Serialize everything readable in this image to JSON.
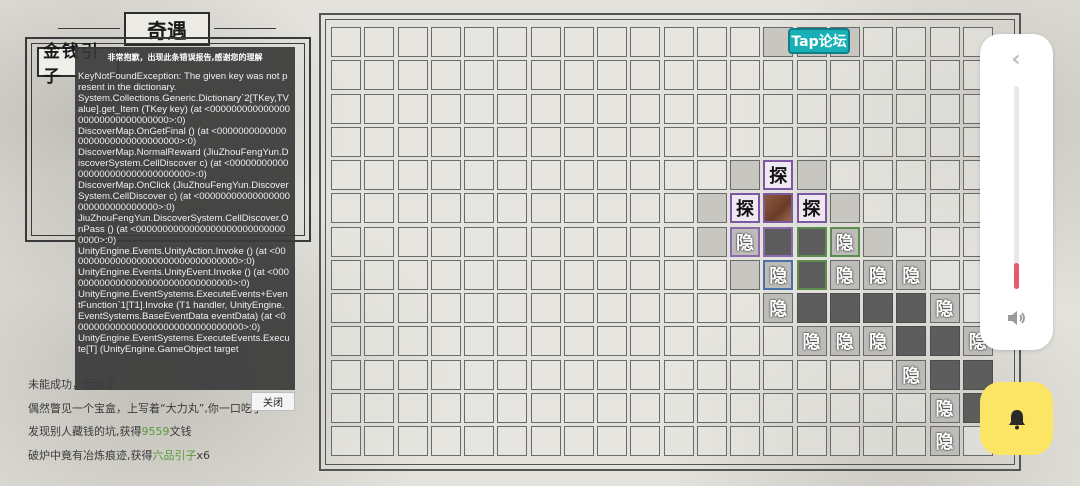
{
  "page": {
    "title": "奇遇"
  },
  "left_panel": {
    "money_label": "金钱引子"
  },
  "error": {
    "title": "非常抱歉，出现此条错误报告,感谢您的理解",
    "message": "KeyNotFoundException: The given key was not present in the dictionary.\nSystem.Collections.Generic.Dictionary`2[TKey,TValue].get_Item (TKey key) (at <00000000000000000000000000000000>:0)\nDiscoverMap.OnGetFinal () (at <00000000000000000000000000000000>:0)\nDiscoverMap.NormalReward (JiuZhouFengYun.DiscoverSystem.CellDiscover c) (at <00000000000000000000000000000000>:0)\nDiscoverMap.OnClick (JiuZhouFengYun.DiscoverSystem.CellDiscover c) (at <00000000000000000000000000000000>:0)\nJiuZhouFengYun.DiscoverSystem.CellDiscover.OnPass () (at <00000000000000000000000000000000>:0)\nUnityEngine.Events.UnityAction.Invoke () (at <00000000000000000000000000000000>:0)\nUnityEngine.Events.UnityEvent.Invoke () (at <00000000000000000000000000000000>:0)\nUnityEngine.EventSystems.ExecuteEvents+EventFunction`1[T1].Invoke (T1 handler, UnityEngine.EventSystems.BaseEventData eventData) (at <00000000000000000000000000000000>:0)\nUnityEngine.EventSystems.ExecuteEvents.Execute[T] (UnityEngine.GameObject target",
    "close_label": "关闭"
  },
  "log": [
    {
      "parts": [
        {
          "text": "未能成功，"
        },
        {
          "text": "后退了"
        }
      ]
    },
    {
      "parts": [
        {
          "text": "偶然瞥见一个宝盒，上写着“大力丸”,你一口吃了"
        }
      ]
    },
    {
      "parts": [
        {
          "text": "发现别人藏钱的坑,获得"
        },
        {
          "text": "9559",
          "hl": true
        },
        {
          "text": "文钱"
        }
      ]
    },
    {
      "parts": [
        {
          "text": "破炉中竟有冶炼痕迹,获得"
        },
        {
          "text": "六品引子",
          "hl": true
        },
        {
          "text": "x6"
        }
      ]
    }
  ],
  "board": {
    "cols": 20,
    "rows": 13,
    "tap_badge": "Tap论坛",
    "special_cells": [
      {
        "r": 4,
        "c": 13,
        "type": "explore",
        "label": "探"
      },
      {
        "r": 5,
        "c": 12,
        "type": "explore",
        "label": "探"
      },
      {
        "r": 5,
        "c": 13,
        "type": "rock",
        "label": ""
      },
      {
        "r": 5,
        "c": 14,
        "type": "explore",
        "label": "探"
      },
      {
        "r": 6,
        "c": 12,
        "type": "hidden",
        "label": "隐",
        "border": "purple"
      },
      {
        "r": 6,
        "c": 13,
        "type": "purple-dark",
        "label": ""
      },
      {
        "r": 6,
        "c": 14,
        "type": "green-dark",
        "label": ""
      },
      {
        "r": 6,
        "c": 15,
        "type": "hidden",
        "label": "隐",
        "border": "green"
      },
      {
        "r": 7,
        "c": 13,
        "type": "hidden",
        "label": "隐",
        "border": "blue"
      },
      {
        "r": 7,
        "c": 14,
        "type": "green-dark",
        "label": ""
      },
      {
        "r": 7,
        "c": 15,
        "type": "hidden",
        "label": "隐"
      },
      {
        "r": 7,
        "c": 16,
        "type": "hidden",
        "label": "隐"
      },
      {
        "r": 7,
        "c": 17,
        "type": "hidden",
        "label": "隐"
      },
      {
        "r": 8,
        "c": 13,
        "type": "hidden",
        "label": "隐"
      },
      {
        "r": 8,
        "c": 14,
        "type": "dark",
        "label": ""
      },
      {
        "r": 8,
        "c": 15,
        "type": "dark",
        "label": ""
      },
      {
        "r": 8,
        "c": 16,
        "type": "dark",
        "label": ""
      },
      {
        "r": 8,
        "c": 17,
        "type": "dark",
        "label": ""
      },
      {
        "r": 8,
        "c": 18,
        "type": "hidden",
        "label": "隐"
      },
      {
        "r": 9,
        "c": 14,
        "type": "hidden",
        "label": "隐"
      },
      {
        "r": 9,
        "c": 15,
        "type": "hidden",
        "label": "隐"
      },
      {
        "r": 9,
        "c": 16,
        "type": "hidden",
        "label": "隐"
      },
      {
        "r": 9,
        "c": 17,
        "type": "dark",
        "label": ""
      },
      {
        "r": 9,
        "c": 18,
        "type": "dark",
        "label": ""
      },
      {
        "r": 9,
        "c": 19,
        "type": "hidden",
        "label": "隐"
      },
      {
        "r": 10,
        "c": 17,
        "type": "hidden",
        "label": "隐"
      },
      {
        "r": 10,
        "c": 18,
        "type": "dark",
        "label": ""
      },
      {
        "r": 10,
        "c": 19,
        "type": "dark",
        "label": ""
      },
      {
        "r": 11,
        "c": 18,
        "type": "hidden",
        "label": "隐"
      },
      {
        "r": 11,
        "c": 19,
        "type": "dark",
        "label": ""
      },
      {
        "r": 12,
        "c": 18,
        "type": "hidden",
        "label": "隐"
      }
    ]
  },
  "volume": {
    "level": 0.13,
    "accent": "#e55a6a"
  },
  "icons": {
    "back": "chevron-left-icon",
    "speaker": "speaker-icon",
    "bell": "bell-icon"
  }
}
